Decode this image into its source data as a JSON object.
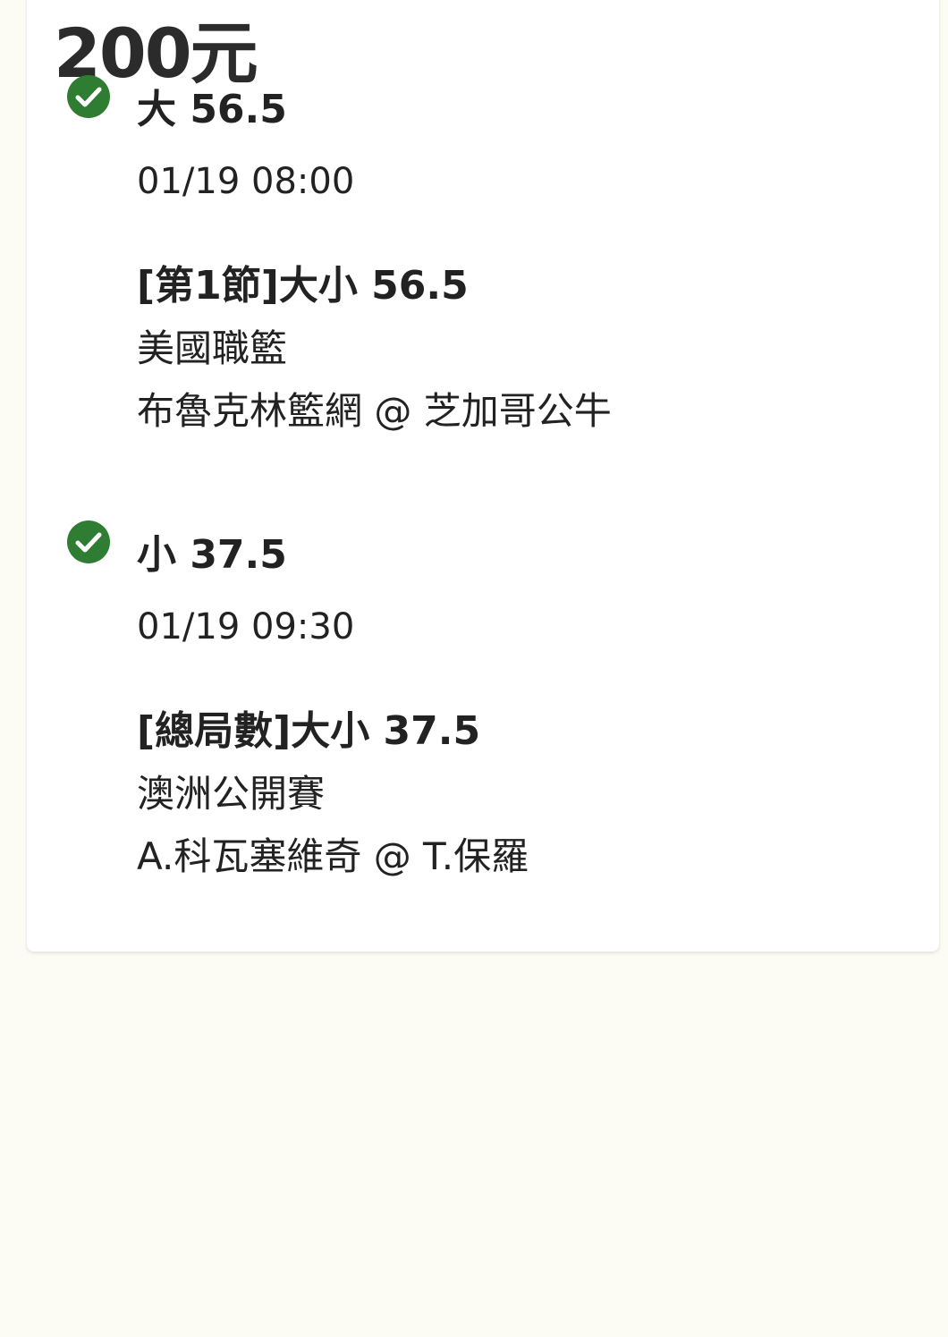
{
  "stake": "200元",
  "selections": [
    {
      "pick": "大 56.5",
      "time": "01/19 08:00",
      "market": "[第1節]大小 56.5",
      "league": "美國職籃",
      "match": "布魯克林籃網 @ 芝加哥公牛",
      "status_icon": "check-circle-icon",
      "status_color": "#2e7d32"
    },
    {
      "pick": "小 37.5",
      "time": "01/19 09:30",
      "market": "[總局數]大小 37.5",
      "league": "澳洲公開賽",
      "match": "A.科瓦塞維奇 @ T.保羅",
      "status_icon": "check-circle-icon",
      "status_color": "#2e7d32"
    }
  ]
}
